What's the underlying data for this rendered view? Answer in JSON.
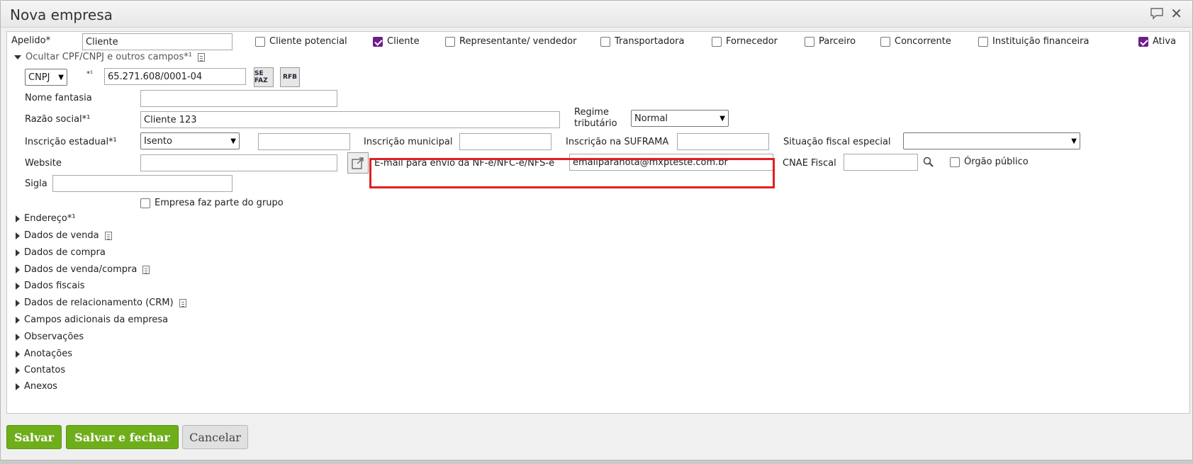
{
  "window": {
    "title": "Nova empresa",
    "close_glyph": "✕"
  },
  "top_row": {
    "apelido_label": "Apelido*",
    "apelido_value": "Cliente",
    "checkboxes": [
      {
        "label": "Cliente potencial",
        "checked": false
      },
      {
        "label": "Cliente",
        "checked": true
      },
      {
        "label": "Representante/ vendedor",
        "checked": false
      },
      {
        "label": "Transportadora",
        "checked": false
      },
      {
        "label": "Fornecedor",
        "checked": false
      },
      {
        "label": "Parceiro",
        "checked": false
      },
      {
        "label": "Concorrente",
        "checked": false
      },
      {
        "label": "Instituição financeira",
        "checked": false
      },
      {
        "label": "Ativa",
        "checked": true
      }
    ]
  },
  "cpf_section": {
    "toggle_label": "Ocultar CPF/CNPJ e outros campos*¹",
    "doc_type": "CNPJ",
    "required_mark": "*¹",
    "doc_value": "65.271.608/0001-04",
    "sefaz_label": "SE FAZ",
    "rfb_label": "RFB"
  },
  "fields": {
    "nome_fantasia_label": "Nome fantasia",
    "nome_fantasia_value": "",
    "razao_social_label": "Razão social*¹",
    "razao_social_value": "Cliente 123",
    "regime_label_1": "Regime",
    "regime_label_2": "tributário",
    "regime_value": "Normal",
    "inscricao_estadual_label": "Inscrição estadual*¹",
    "inscricao_estadual_value": "Isento",
    "inscricao_municipal_label": "Inscrição municipal",
    "inscricao_suframa_label": "Inscrição na SUFRAMA",
    "situacao_fiscal_label": "Situação fiscal especial",
    "situacao_fiscal_value": "",
    "website_label": "Website",
    "email_nf_label": "E-mail para envio da NF-e/NFC-e/NFS-e",
    "email_nf_value": "emailparanota@mxpteste.com.br",
    "cnae_label": "CNAE Fiscal",
    "orgao_publico_label": "Órgão público",
    "sigla_label": "Sigla",
    "grupo_label": "Empresa faz parte do grupo"
  },
  "sections": [
    {
      "label": "Endereço*¹",
      "has_doc": false
    },
    {
      "label": "Dados de venda",
      "has_doc": true
    },
    {
      "label": "Dados de compra",
      "has_doc": false
    },
    {
      "label": "Dados de venda/compra",
      "has_doc": true
    },
    {
      "label": "Dados fiscais",
      "has_doc": false
    },
    {
      "label": "Dados de relacionamento (CRM)",
      "has_doc": true
    },
    {
      "label": "Campos adicionais da empresa",
      "has_doc": false
    },
    {
      "label": "Observações",
      "has_doc": false
    },
    {
      "label": "Anotações",
      "has_doc": false
    },
    {
      "label": "Contatos",
      "has_doc": false
    },
    {
      "label": "Anexos",
      "has_doc": false
    }
  ],
  "buttons": {
    "save": "Salvar",
    "save_close": "Salvar e fechar",
    "cancel": "Cancelar"
  },
  "colors": {
    "checkbox_checked": "#6b1f8a",
    "primary_button": "#6fae1b",
    "highlight": "#e02020"
  }
}
